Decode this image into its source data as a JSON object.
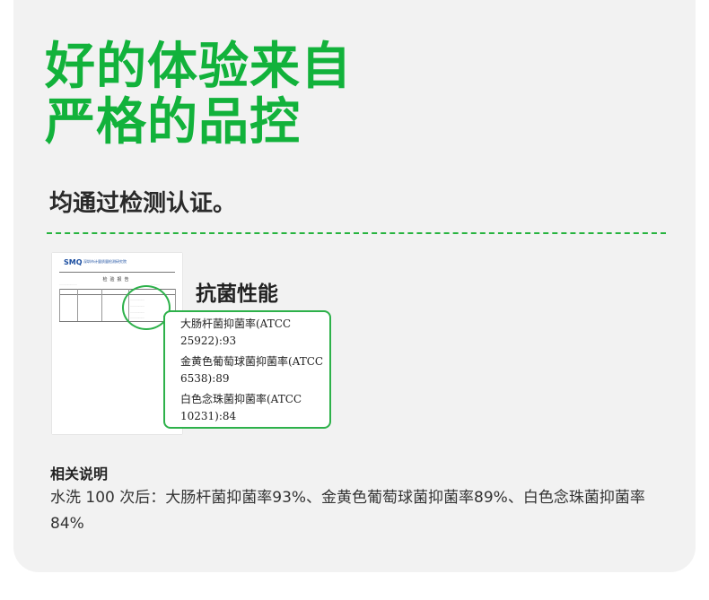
{
  "headline": {
    "line1": "好的体验来自",
    "line2": "严格的品控"
  },
  "subtitle": "均通过检测认证。",
  "report": {
    "logo": "SMQ",
    "org_name": "深圳市计量质量检测研究院",
    "title": "检验报告"
  },
  "property_title": "抗菌性能",
  "results": [
    "大肠杆菌抑菌率(ATCC",
    "25922):93",
    "金黄色葡萄球菌抑菌率(ATCC",
    "6538):89",
    "白色念珠菌抑菌率(ATCC",
    "10231):84"
  ],
  "notes": {
    "heading": "相关说明",
    "body": "水洗 100 次后：大肠杆菌抑菌率93%、金黄色葡萄球菌抑菌率89%、白色念珠菌抑菌率84%"
  },
  "colors": {
    "accent_green": "#12b23b",
    "card_background": "#f2f2f2",
    "outline_green": "#2db14a"
  }
}
